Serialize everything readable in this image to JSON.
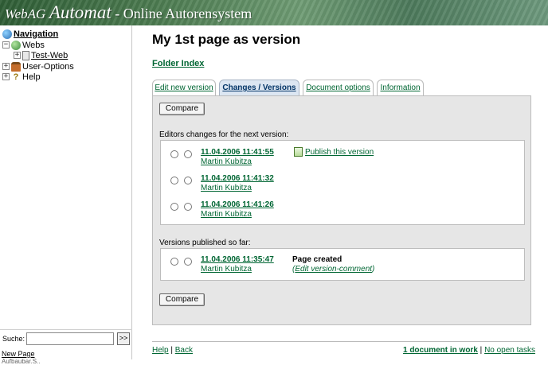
{
  "banner": {
    "brand_part1": "WebAG",
    "brand_part2": "Automat",
    "suffix": " - Online Autorensystem"
  },
  "sidebar": {
    "navigation_label": "Navigation",
    "tree": [
      {
        "label": "Webs"
      },
      {
        "label": "Test-Web"
      },
      {
        "label": "User-Options"
      },
      {
        "label": "Help"
      }
    ],
    "search_label": "Suche:",
    "search_value": "",
    "search_button": ">>",
    "new_page": "New Page",
    "new_page_sub": "Aufbaubar.S.."
  },
  "main": {
    "page_title": "My 1st page as version",
    "folder_index": "Folder Index",
    "tabs": [
      {
        "label": "Edit new version"
      },
      {
        "label": "Changes / Versions"
      },
      {
        "label": "Document options"
      },
      {
        "label": "Information"
      }
    ],
    "compare_label": "Compare",
    "editors_changes_label": "Editors changes for the next version:",
    "pending_versions": [
      {
        "date": "11.04.2006 11:41:55",
        "author": "Martin Kubitza",
        "action": "Publish this version"
      },
      {
        "date": "11.04.2006 11:41:32",
        "author": "Martin Kubitza"
      },
      {
        "date": "11.04.2006 11:41:26",
        "author": "Martin Kubitza"
      }
    ],
    "published_label": "Versions published so far:",
    "published_versions": [
      {
        "date": "11.04.2006 11:35:47",
        "author": "Martin Kubitza",
        "comment": "Page created",
        "edit_comment": "Edit version-comment"
      }
    ]
  },
  "footer": {
    "help": "Help",
    "back": "Back",
    "separator": "|",
    "docs_in_work": "1 document in work",
    "open_tasks": "No open tasks"
  }
}
